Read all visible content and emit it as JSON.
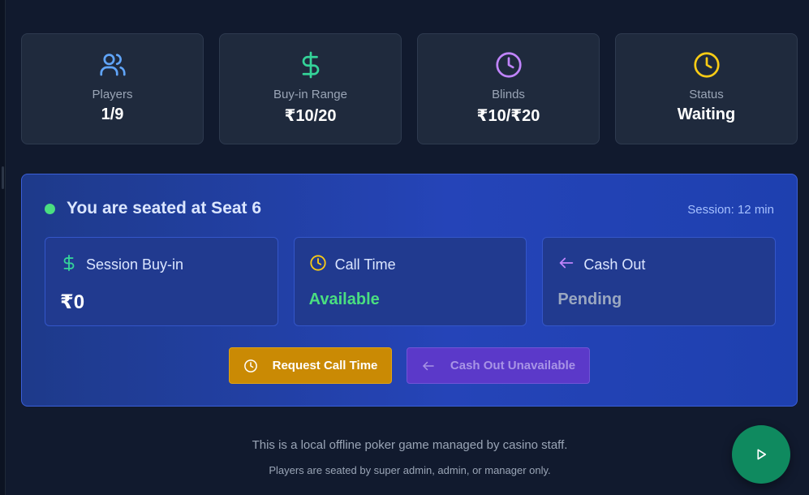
{
  "stats": [
    {
      "icon": "users-icon",
      "label": "Players",
      "value": "1/9",
      "color": "#60a5fa"
    },
    {
      "icon": "dollar-icon",
      "label": "Buy-in Range",
      "value": "₹10/20",
      "color": "#34d399"
    },
    {
      "icon": "clock-icon",
      "label": "Blinds",
      "value": "₹10/₹20",
      "color": "#c084fc"
    },
    {
      "icon": "clock-icon",
      "label": "Status",
      "value": "Waiting",
      "color": "#facc15"
    }
  ],
  "seat": {
    "title": "You are seated at Seat 6",
    "session": "Session: 12 min",
    "cards": [
      {
        "icon": "dollar-icon",
        "title": "Session Buy-in",
        "value": "₹0",
        "color": "#34d399"
      },
      {
        "icon": "clock-icon",
        "title": "Call Time",
        "value": "Available",
        "color": "#facc15"
      },
      {
        "icon": "arrow-left-icon",
        "title": "Cash Out",
        "value": "Pending",
        "color": "#c084fc"
      }
    ],
    "buttons": {
      "call_time": "Request Call Time",
      "cash_out": "Cash Out Unavailable"
    }
  },
  "footer": {
    "line1": "This is a local offline poker game managed by casino staff.",
    "line2": "Players are seated by super admin, admin, or manager only."
  }
}
